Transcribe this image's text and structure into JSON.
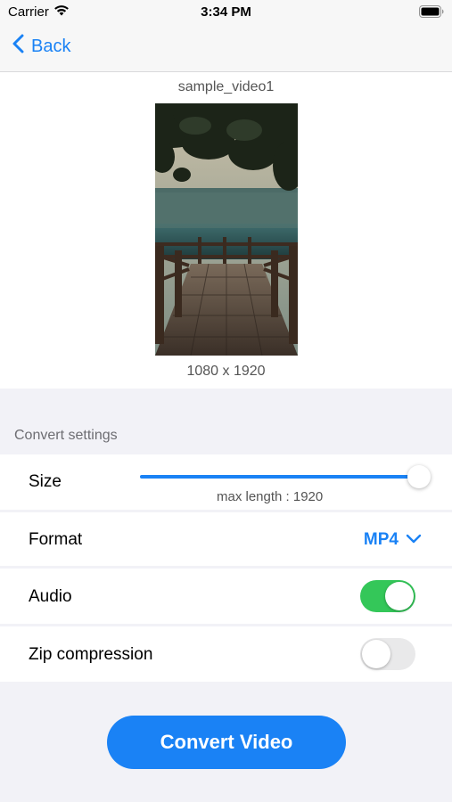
{
  "status_bar": {
    "carrier": "Carrier",
    "time": "3:34 PM"
  },
  "nav": {
    "back_label": "Back"
  },
  "video": {
    "name": "sample_video1",
    "resolution": "1080 x 1920"
  },
  "settings": {
    "section_title": "Convert settings",
    "size": {
      "label": "Size",
      "caption": "max length : 1920",
      "value_fraction": 1.0
    },
    "format": {
      "label": "Format",
      "value": "MP4"
    },
    "audio": {
      "label": "Audio",
      "enabled": true
    },
    "zip": {
      "label": "Zip compression",
      "enabled": false
    }
  },
  "convert_button": {
    "label": "Convert Video"
  },
  "colors": {
    "accent": "#1a82f5",
    "toggle_on": "#34c759",
    "background": "#f2f2f7"
  }
}
